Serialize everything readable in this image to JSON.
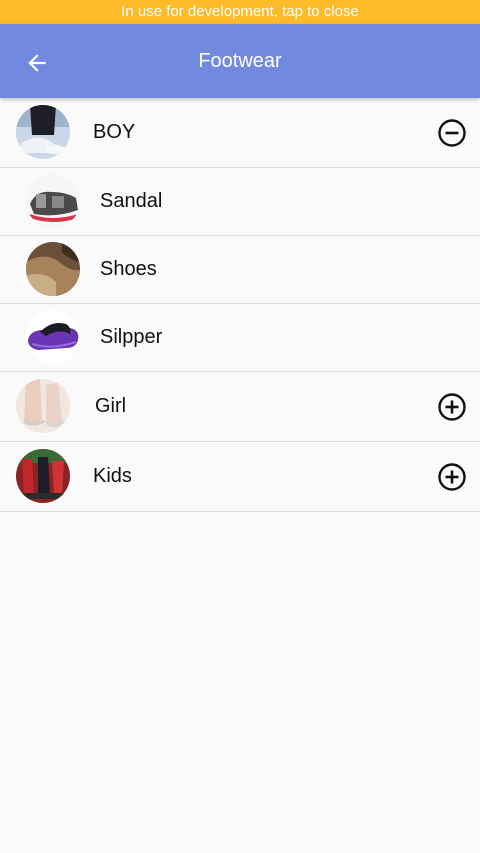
{
  "banner": {
    "text": "In use for development, tap to close"
  },
  "app_bar": {
    "title": "Footwear",
    "back_icon": "arrow-left-icon"
  },
  "categories": [
    {
      "label": "BOY",
      "expanded": true,
      "toggle_icon": "minus-circle-icon",
      "children": [
        {
          "label": "Sandal"
        },
        {
          "label": "Shoes"
        },
        {
          "label": "Silpper"
        }
      ]
    },
    {
      "label": "Girl",
      "expanded": false,
      "toggle_icon": "plus-circle-icon"
    },
    {
      "label": "Kids",
      "expanded": false,
      "toggle_icon": "plus-circle-icon"
    }
  ],
  "colors": {
    "banner": "#fdbb2a",
    "app_bar": "#7289e0",
    "background": "#fafafa",
    "divider": "#dedede"
  }
}
